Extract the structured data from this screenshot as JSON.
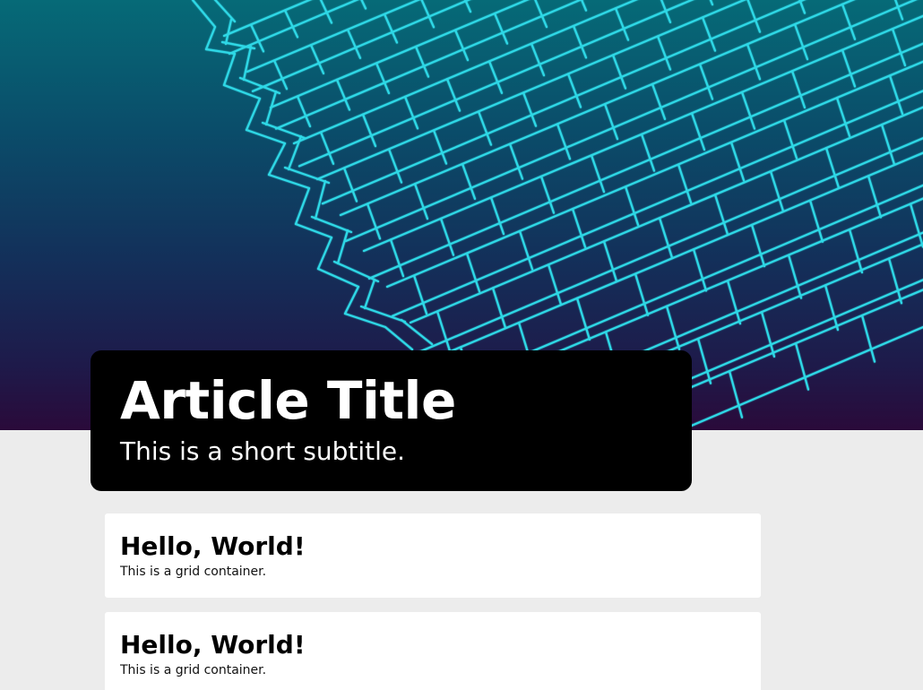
{
  "header": {
    "title": "Article Title",
    "subtitle": "This is a short subtitle."
  },
  "cards": [
    {
      "heading": "Hello, World!",
      "body": "This is a grid container."
    },
    {
      "heading": "Hello, World!",
      "body": "This is a grid container."
    }
  ],
  "colors": {
    "background": "#ececec",
    "title_card": "#000000",
    "wireframe": "#2fd8e6",
    "card": "#ffffff"
  },
  "hero_image": {
    "icon": "wireframe-grid-image"
  }
}
